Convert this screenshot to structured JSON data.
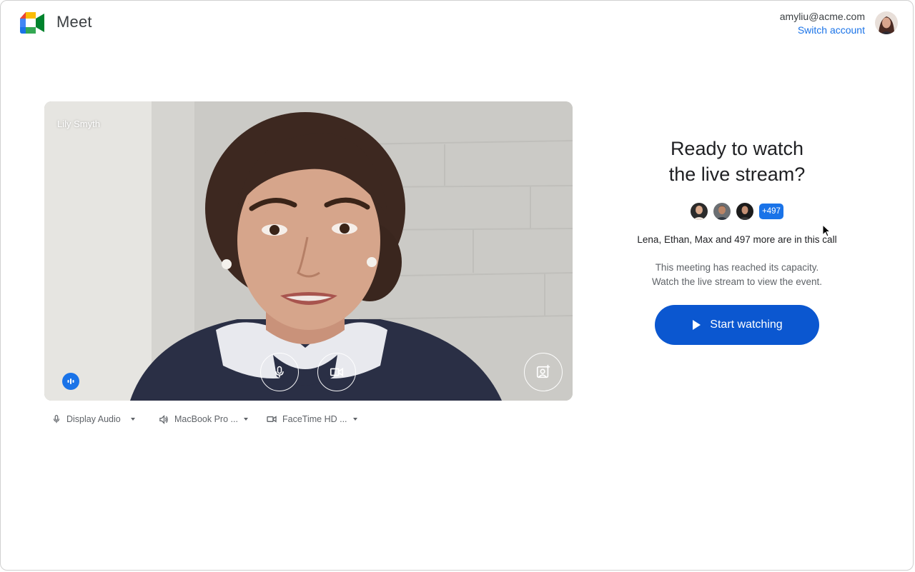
{
  "header": {
    "app_name": "Meet",
    "account_email": "amyliu@acme.com",
    "switch_account_label": "Switch account"
  },
  "preview": {
    "participant_name": "Lily Smyth",
    "icons": {
      "audio_level": "audio-level-icon",
      "mic": "mic-icon",
      "camera": "videocam-icon",
      "effects": "background-effects-icon"
    }
  },
  "devices": [
    {
      "icon": "mic-icon",
      "label": "Display Audio"
    },
    {
      "icon": "speaker-icon",
      "label": "MacBook Pro ..."
    },
    {
      "icon": "videocam-icon",
      "label": "FaceTime HD ..."
    }
  ],
  "join_panel": {
    "title_line1": "Ready to watch",
    "title_line2": "the live stream?",
    "more_count": "+497",
    "in_call_text": "Lena, Ethan, Max and 497 more are in this call",
    "capacity_line1": "This meeting has reached its capacity.",
    "capacity_line2": "Watch the live stream to view the event.",
    "start_button": "Start watching"
  },
  "colors": {
    "accent": "#1a73e8",
    "button": "#0b57d0"
  }
}
